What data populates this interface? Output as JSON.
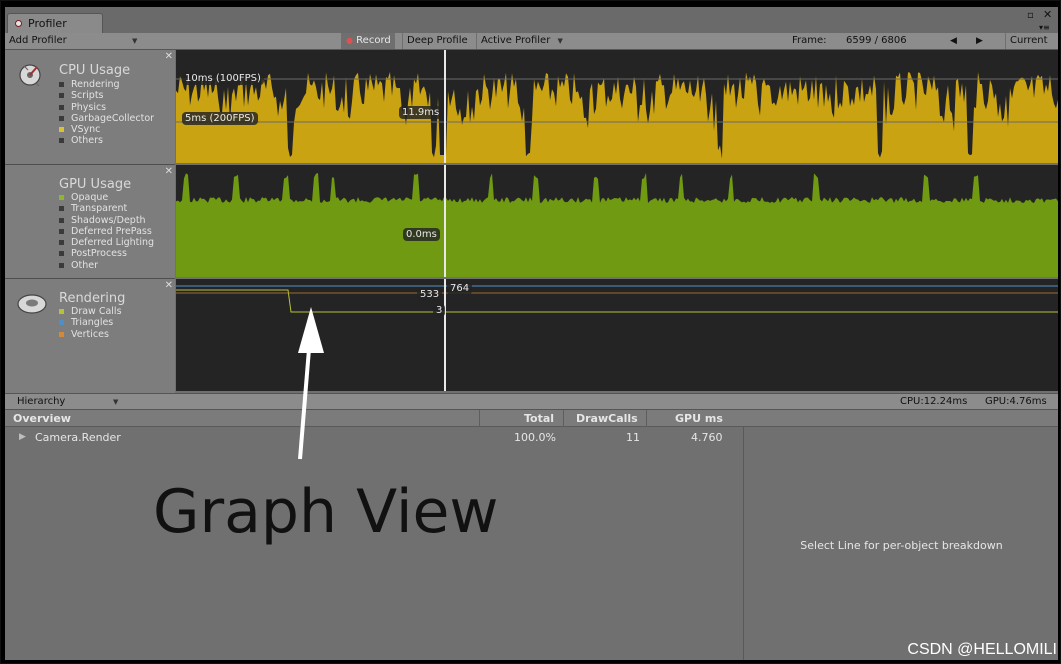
{
  "window": {
    "tab_title": "Profiler"
  },
  "toolbar": {
    "add_profiler": "Add Profiler",
    "record": "Record",
    "deep_profile": "Deep Profile",
    "active_profiler": "Active Profiler",
    "frame_label": "Frame:",
    "frame_value": "6599 / 6806",
    "current": "Current"
  },
  "modules": {
    "cpu": {
      "title": "CPU Usage",
      "legend": [
        {
          "label": "Rendering",
          "color": "#3a3a3a"
        },
        {
          "label": "Scripts",
          "color": "#3a3a3a"
        },
        {
          "label": "Physics",
          "color": "#3a3a3a"
        },
        {
          "label": "GarbageCollector",
          "color": "#3a3a3a"
        },
        {
          "label": "VSync",
          "color": "#d7c23a"
        },
        {
          "label": "Others",
          "color": "#3a3a3a"
        }
      ],
      "labels": {
        "top": "10ms (100FPS)",
        "mid": "5ms (200FPS)",
        "value": "11.9ms"
      },
      "color": "#c9a312"
    },
    "gpu": {
      "title": "GPU Usage",
      "legend": [
        {
          "label": "Opaque",
          "color": "#8fb631"
        },
        {
          "label": "Transparent",
          "color": "#3a3a3a"
        },
        {
          "label": "Shadows/Depth",
          "color": "#3a3a3a"
        },
        {
          "label": "Deferred PrePass",
          "color": "#3a3a3a"
        },
        {
          "label": "Deferred Lighting",
          "color": "#3a3a3a"
        },
        {
          "label": "PostProcess",
          "color": "#3a3a3a"
        },
        {
          "label": "Other",
          "color": "#3a3a3a"
        }
      ],
      "labels": {
        "value": "0.0ms"
      },
      "color": "#6f9a12"
    },
    "rendering": {
      "title": "Rendering",
      "legend": [
        {
          "label": "Draw Calls",
          "color": "#b6c23a"
        },
        {
          "label": "Triangles",
          "color": "#4f8fc7"
        },
        {
          "label": "Vertices",
          "color": "#d18a3a"
        }
      ],
      "labels": {
        "triangles": "764",
        "vertices": "533",
        "drawcalls": "3"
      }
    }
  },
  "hierarchy": {
    "mode": "Hierarchy",
    "cpu_stat": "CPU:12.24ms",
    "gpu_stat": "GPU:4.76ms",
    "columns": {
      "overview": "Overview",
      "total": "Total",
      "drawcalls": "DrawCalls",
      "gpu_ms": "GPU ms"
    },
    "rows": [
      {
        "name": "Camera.Render",
        "total": "100.0%",
        "drawcalls": "11",
        "gpu_ms": "4.760"
      }
    ],
    "detail_hint": "Select Line for per-object breakdown"
  },
  "annotation": "Graph View",
  "watermark": "CSDN @HELLOMILI"
}
